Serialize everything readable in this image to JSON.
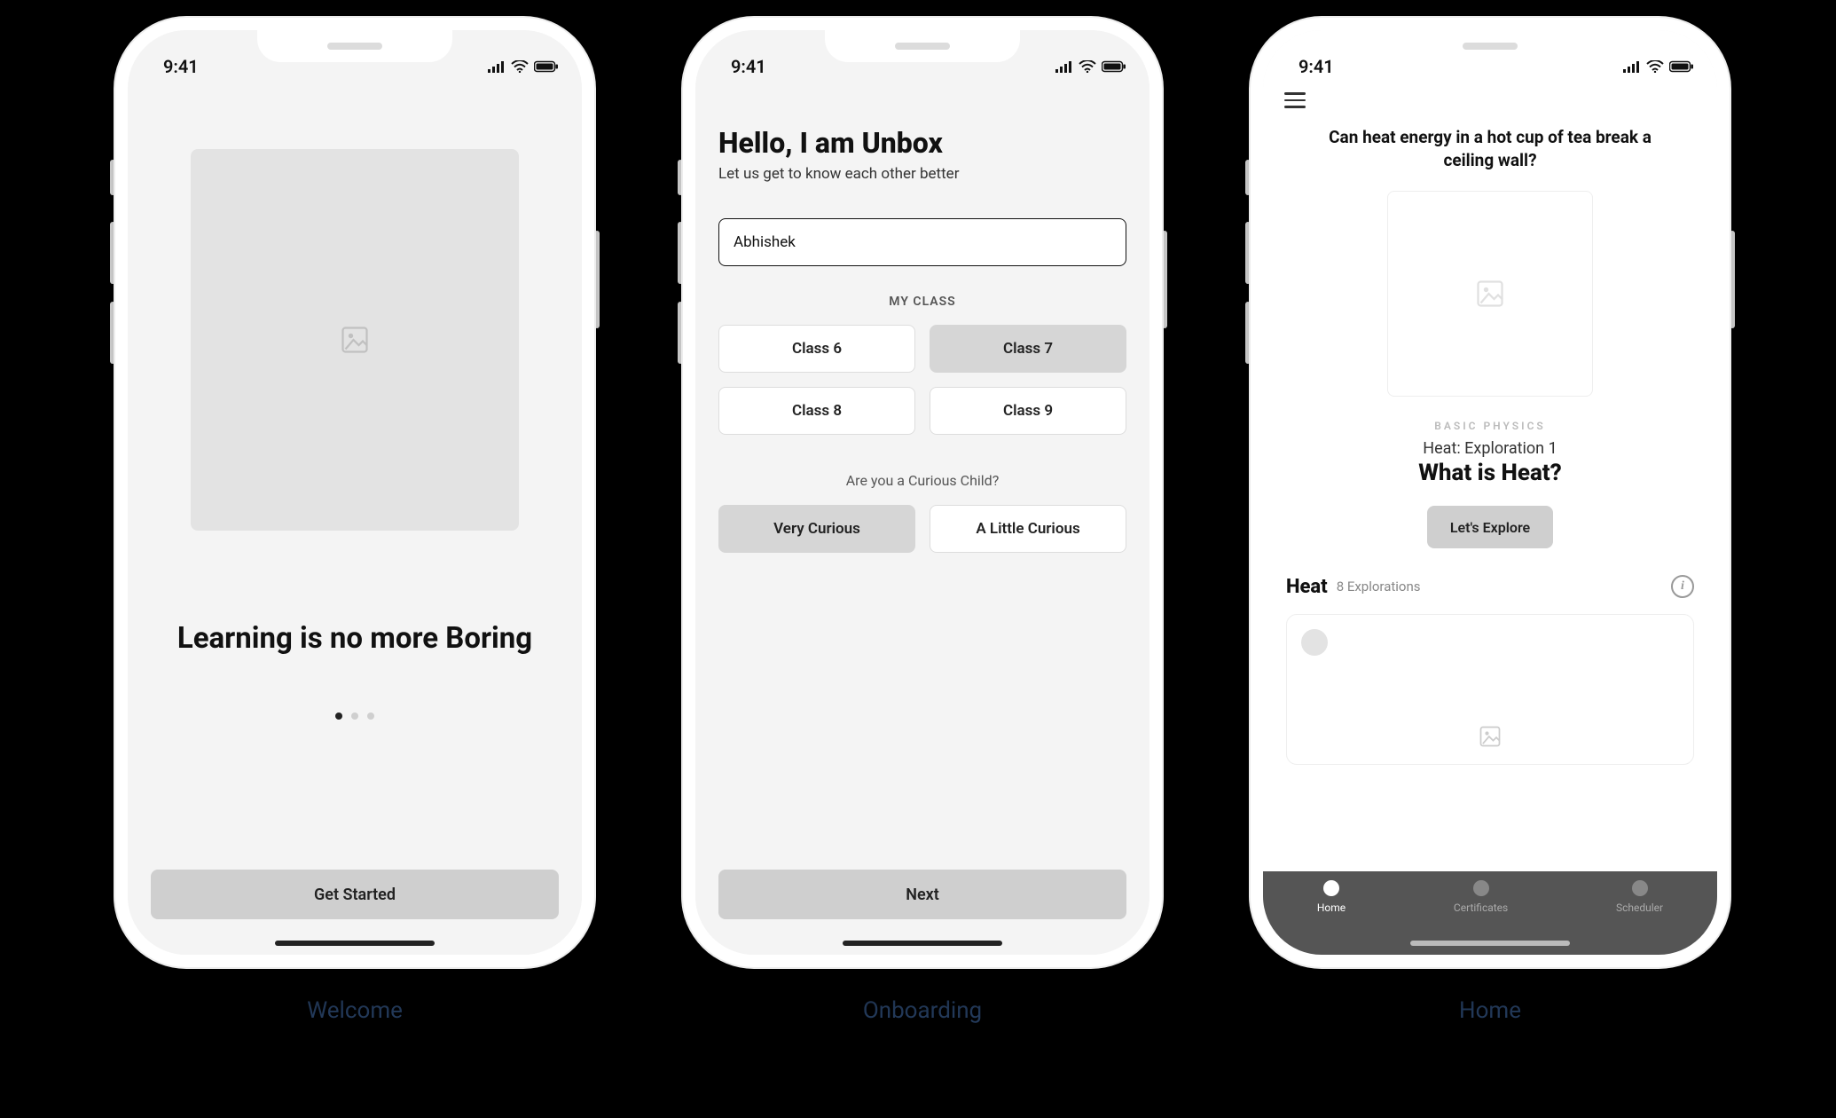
{
  "status": {
    "time": "9:41"
  },
  "screens": {
    "welcome": {
      "caption": "Welcome",
      "headline": "Learning is no more Boring",
      "cta": "Get Started"
    },
    "onboarding": {
      "caption": "Onboarding",
      "title": "Hello, I am Unbox",
      "subtitle": "Let us get to know each other better",
      "name_value": "Abhishek",
      "class_label": "MY CLASS",
      "classes": [
        "Class 6",
        "Class 7",
        "Class 8",
        "Class 9"
      ],
      "selected_class_index": 1,
      "curious_question": "Are you a Curious Child?",
      "curious_options": [
        "Very Curious",
        "A Little Curious"
      ],
      "selected_curious_index": 0,
      "cta": "Next"
    },
    "home": {
      "caption": "Home",
      "prompt": "Can heat energy in a hot cup of tea break a ceiling wall?",
      "subject": "BASIC PHYSICS",
      "exploration_sub": "Heat: Exploration 1",
      "exploration_title": "What is Heat?",
      "explore_cta": "Let's Explore",
      "section_title": "Heat",
      "section_count": "8 Explorations",
      "tabs": [
        "Home",
        "Certificates",
        "Scheduler"
      ],
      "active_tab_index": 0
    }
  }
}
